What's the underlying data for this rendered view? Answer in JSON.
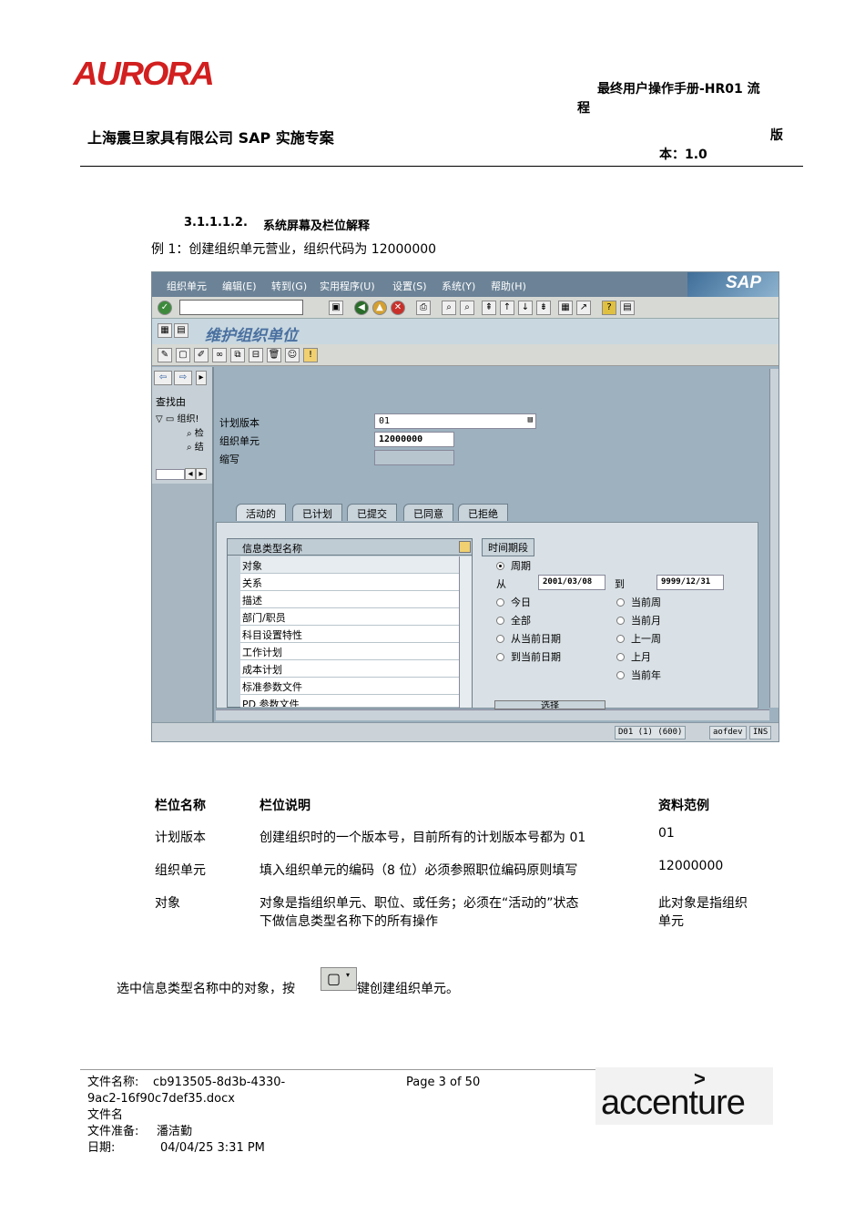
{
  "header": {
    "logo_text": "AURORA",
    "manual_title_line1": "最终用户操作手册-HR01 流",
    "manual_title_line2": "程",
    "project": "上海震旦家具有限公司 SAP 实施专案",
    "version_line1": "版",
    "version_line2": "本：1.0"
  },
  "section": {
    "number": "3.1.1.1.2.",
    "title": "系统屏幕及栏位解释",
    "example": "例 1：创建组织单元营业，组织代码为 12000000"
  },
  "sap_screen": {
    "menu": [
      "组织单元",
      "编辑(E)",
      "转到(G)",
      "实用程序(U)",
      "设置(S)",
      "系统(Y)",
      "帮助(H)"
    ],
    "logo": "SAP",
    "title": "维护组织单位",
    "left_pane": {
      "find_by": "查找由",
      "tree_root": "组织!",
      "tree_child1": "检",
      "tree_child2": "结"
    },
    "fields": {
      "plan_version_label": "计划版本",
      "plan_version_value": "01",
      "org_unit_label": "组织单元",
      "org_unit_value": "12000000",
      "abbrev_label": "缩写"
    },
    "tabs": [
      "活动的",
      "已计划",
      "已提交",
      "已同意",
      "已拒绝"
    ],
    "grid": {
      "header": "信息类型名称",
      "rows": [
        "对象",
        "关系",
        "描述",
        "部门/职员",
        "科目设置特性",
        "工作计划",
        "成本计划",
        "标准参数文件",
        "PD 参数文件"
      ]
    },
    "period": {
      "title": "时间期段",
      "period_label": "周期",
      "from_label": "从",
      "from_value": "2001/03/08",
      "to_label": "到",
      "to_value": "9999/12/31",
      "options_left": [
        "今日",
        "全部",
        "从当前日期",
        "到当前日期"
      ],
      "options_right": [
        "当前周",
        "当前月",
        "上一周",
        "上月",
        "当前年"
      ],
      "select_button": "选择"
    },
    "status": {
      "system": "D01 (1) (600)",
      "server": "aofdev",
      "mode": "INS"
    }
  },
  "field_table": {
    "headers": [
      "栏位名称",
      "栏位说明",
      "资料范例"
    ],
    "rows": [
      {
        "name": "计划版本",
        "desc": "创建组织时的一个版本号，目前所有的计划版本号都为 01",
        "desc2": "",
        "example": "01",
        "example2": ""
      },
      {
        "name": "组织单元",
        "desc": "填入组织单元的编码（8 位）必须参照职位编码原则填写",
        "desc2": "",
        "example": "12000000",
        "example2": ""
      },
      {
        "name": "对象",
        "desc": "对象是指组织单元、职位、或任务；必须在“活动的”状态",
        "desc2": "下做信息类型名称下的所有操作",
        "example": "此对象是指组织",
        "example2": "单元"
      }
    ]
  },
  "instruction": {
    "before": "选中信息类型名称中的对象，按",
    "after": "键创建组织单元。"
  },
  "footer": {
    "file_name_label": "文件名称:",
    "file_name_value1": "cb913505-8d3b-4330-",
    "file_name_value2": "9ac2-16f90c7def35.docx",
    "file_label2": "文件名",
    "prepared_label": "文件准备:",
    "prepared_value": "潘洁勤",
    "date_label": "日期:",
    "date_value": "04/04/25 3:31 PM",
    "page": "Page 3 of 50",
    "accenture_logo": "accenture"
  }
}
